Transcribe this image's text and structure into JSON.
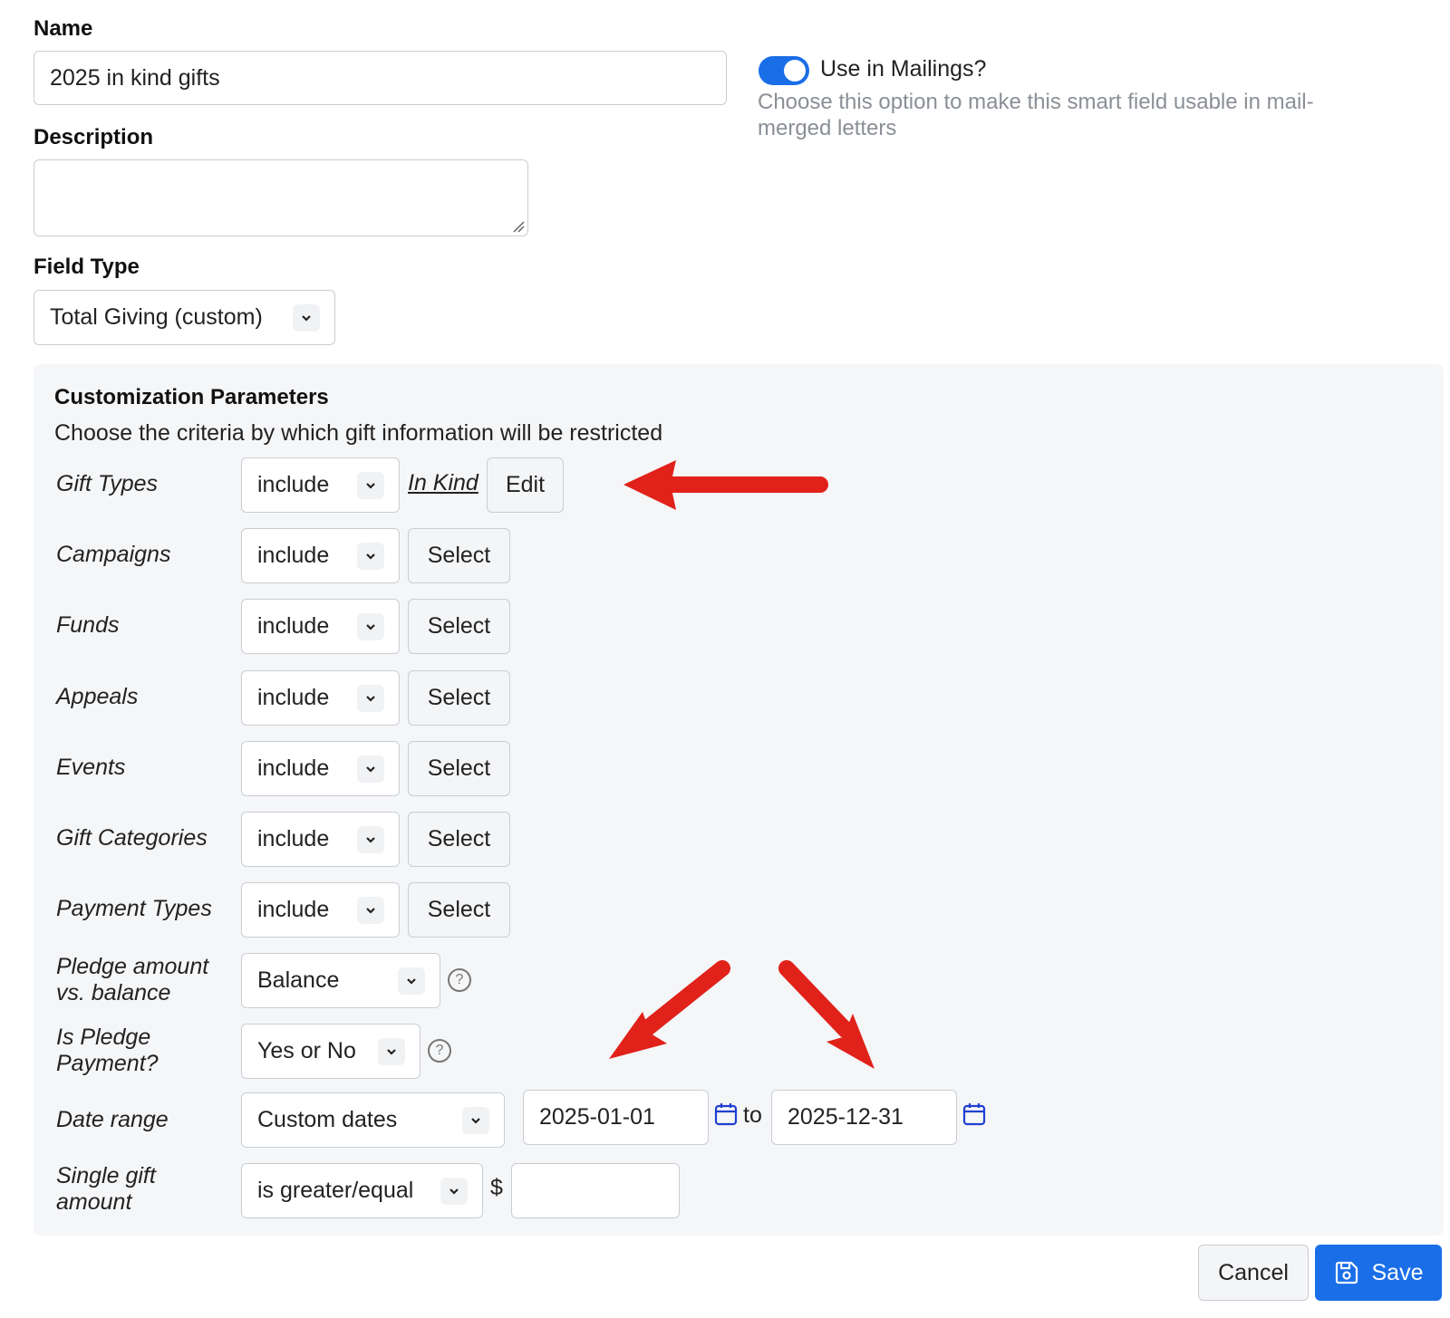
{
  "name_section": {
    "label": "Name",
    "value": "2025 in kind gifts"
  },
  "mailings": {
    "toggle_label": "Use in Mailings?",
    "help_line1": "Choose this option to make this smart field usable in mail-",
    "help_line2": "merged letters",
    "enabled": true
  },
  "description": {
    "label": "Description",
    "value": ""
  },
  "field_type": {
    "label": "Field Type",
    "selected": "Total Giving (custom)"
  },
  "customization": {
    "title": "Customization Parameters",
    "subtitle": "Choose the criteria by which gift information will be restricted",
    "gift_types": {
      "label": "Gift Types",
      "mode": "include",
      "value_link": "In Kind",
      "button": "Edit"
    },
    "campaigns": {
      "label": "Campaigns",
      "mode": "include",
      "button": "Select"
    },
    "funds": {
      "label": "Funds",
      "mode": "include",
      "button": "Select"
    },
    "appeals": {
      "label": "Appeals",
      "mode": "include",
      "button": "Select"
    },
    "events": {
      "label": "Events",
      "mode": "include",
      "button": "Select"
    },
    "gift_categories": {
      "label": "Gift Categories",
      "mode": "include",
      "button": "Select"
    },
    "payment_types": {
      "label": "Payment Types",
      "mode": "include",
      "button": "Select"
    },
    "pledge_amount": {
      "label_line1": "Pledge amount",
      "label_line2": "vs. balance",
      "selected": "Balance",
      "help": "?"
    },
    "is_pledge": {
      "label_line1": "Is Pledge",
      "label_line2": "Payment?",
      "selected": "Yes or No",
      "help": "?"
    },
    "date_range": {
      "label": "Date range",
      "selected": "Custom dates",
      "from": "2025-01-01",
      "to_label": "to",
      "to": "2025-12-31"
    },
    "single_gift": {
      "label_line1": "Single gift",
      "label_line2": "amount",
      "operator": "is greater/equal",
      "currency": "$",
      "amount": ""
    }
  },
  "actions": {
    "cancel": "Cancel",
    "save": "Save"
  },
  "colors": {
    "accent": "#1a6ee8",
    "annotation_arrow": "#e0221a",
    "calendar_icon": "#1f3fd1"
  },
  "icons": [
    "chevron-down-icon",
    "help-circle-icon",
    "calendar-icon",
    "floppy-disk-icon",
    "resize-handle-icon",
    "annotation-arrow"
  ]
}
